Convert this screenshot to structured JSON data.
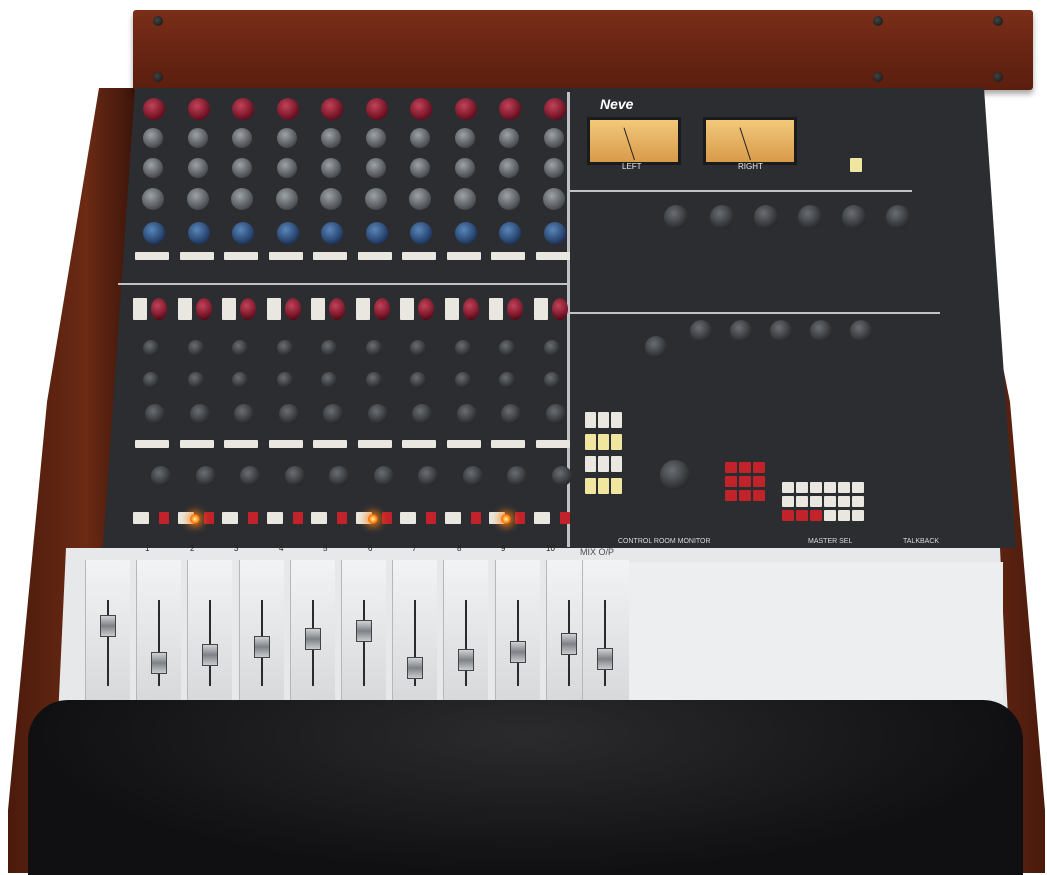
{
  "brand": {
    "logo": "Neve"
  },
  "meters": {
    "left_label": "LEFT",
    "right_label": "RIGHT"
  },
  "sections": {
    "mix_output": "MIX O/P",
    "control_room": "CONTROL ROOM MONITOR",
    "master": "MASTER SEL",
    "talkback": "TALKBACK"
  },
  "channels": [
    "1",
    "2",
    "3",
    "4",
    "5",
    "6",
    "7",
    "8",
    "9",
    "10"
  ],
  "lit_channels": [
    2,
    6,
    9
  ],
  "colors": {
    "wood": "#6a2614",
    "panel": "#2b2d31",
    "fader_bay": "#e6e8ea",
    "armrest": "#121214",
    "lamp": "#ff8a10"
  }
}
